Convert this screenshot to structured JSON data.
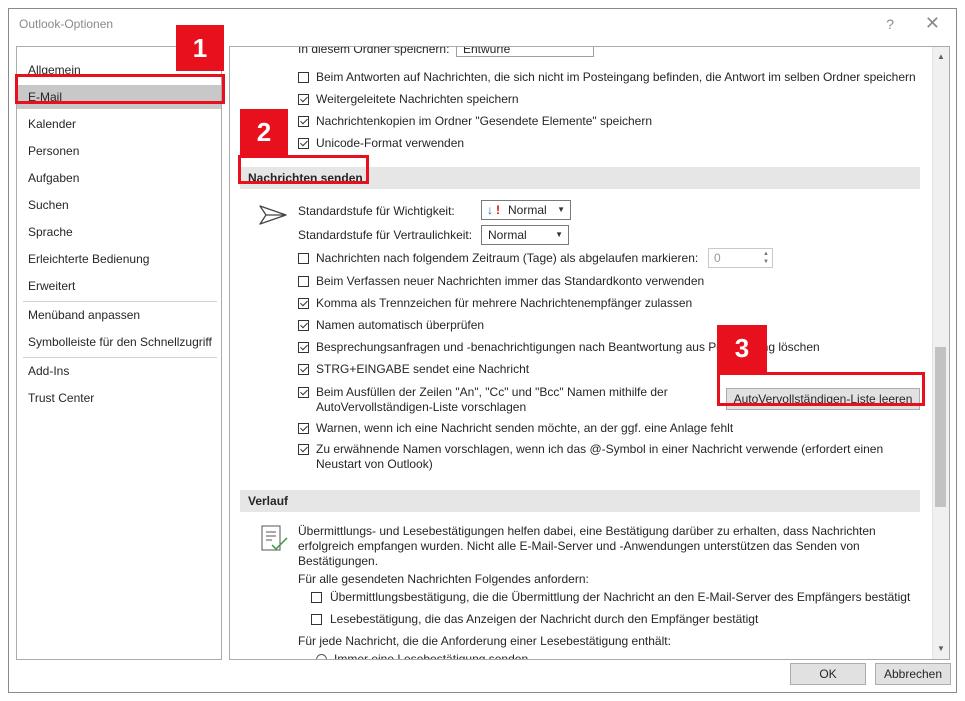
{
  "window": {
    "title": "Outlook-Optionen",
    "help": "?",
    "close": "✕"
  },
  "nav": {
    "items": [
      "Allgemein",
      "E-Mail",
      "Kalender",
      "Personen",
      "Aufgaben",
      "Suchen",
      "Sprache",
      "Erleichterte Bedienung",
      "Erweitert",
      "Menüband anpassen",
      "Symbolleiste für den Schnellzugriff",
      "Add-Ins",
      "Trust Center"
    ],
    "selected": "E-Mail"
  },
  "top": {
    "partial_label": "In diesem Ordner speichern:",
    "partial_value": "Entwürfe",
    "rows": [
      {
        "label": "Beim Antworten auf Nachrichten, die sich nicht im Posteingang befinden, die Antwort im selben Ordner speichern",
        "checked": false
      },
      {
        "label": "Weitergeleitete Nachrichten speichern",
        "checked": true
      },
      {
        "label": "Nachrichtenkopien im Ordner \"Gesendete Elemente\" speichern",
        "checked": true
      },
      {
        "label": "Unicode-Format verwenden",
        "checked": true
      }
    ]
  },
  "send": {
    "heading": "Nachrichten senden",
    "importance_label": "Standardstufe für Wichtigkeit:",
    "importance_value": "Normal",
    "confidential_label": "Standardstufe für Vertraulichkeit:",
    "confidential_value": "Normal",
    "expire_label": "Nachrichten nach folgendem Zeitraum (Tage) als abgelaufen markieren:",
    "expire_value": "0",
    "rows": [
      {
        "label": "Beim Verfassen neuer Nachrichten immer das Standardkonto verwenden",
        "checked": false
      },
      {
        "label": "Komma als Trennzeichen für mehrere Nachrichtenempfänger zulassen",
        "checked": true
      },
      {
        "label": "Namen automatisch überprüfen",
        "checked": true
      },
      {
        "label": "Besprechungsanfragen und -benachrichtigungen nach Beantwortung aus Posteingang löschen",
        "checked": true
      },
      {
        "label": "STRG+EINGABE sendet eine Nachricht",
        "checked": true
      }
    ],
    "autocomplete_line1": "Beim Ausfüllen der Zeilen \"An\", \"Cc\" und \"Bcc\" Namen mithilfe der",
    "autocomplete_line2": "AutoVervollständigen-Liste vorschlagen",
    "autocomplete_button": "AutoVervollständigen-Liste leeren",
    "attachment_warn": "Warnen, wenn ich eine Nachricht senden möchte, an der ggf. eine Anlage fehlt",
    "mention_line1": "Zu erwähnende Namen vorschlagen, wenn ich das @-Symbol in einer Nachricht verwende (erfordert einen",
    "mention_line2": "Neustart von Outlook)"
  },
  "history": {
    "heading": "Verlauf",
    "desc_line1": "Übermittlungs- und Lesebestätigungen helfen dabei, eine Bestätigung darüber zu erhalten, dass Nachrichten",
    "desc_line2": "erfolgreich empfangen wurden. Nicht alle E-Mail-Server und -Anwendungen unterstützen das Senden von",
    "desc_line3": "Bestätigungen.",
    "request_label": "Für alle gesendeten Nachrichten Folgendes anfordern:",
    "delivery_receipt": "Übermittlungsbestätigung, die die Übermittlung der Nachricht an den E-Mail-Server des Empfängers bestätigt",
    "read_receipt": "Lesebestätigung, die das Anzeigen der Nachricht durch den Empfänger bestätigt",
    "each_label": "Für jede Nachricht, die die Anforderung einer Lesebestätigung enthält:",
    "always_send": "Immer eine Lesebestätigung senden"
  },
  "buttons": {
    "ok": "OK",
    "cancel": "Abbrechen"
  },
  "annotations": {
    "one": "1",
    "two": "2",
    "three": "3"
  },
  "colors": {
    "annotation_red": "#e8101c",
    "selected_nav": "#c8c8c8",
    "section_bg": "#e6e6e6"
  }
}
